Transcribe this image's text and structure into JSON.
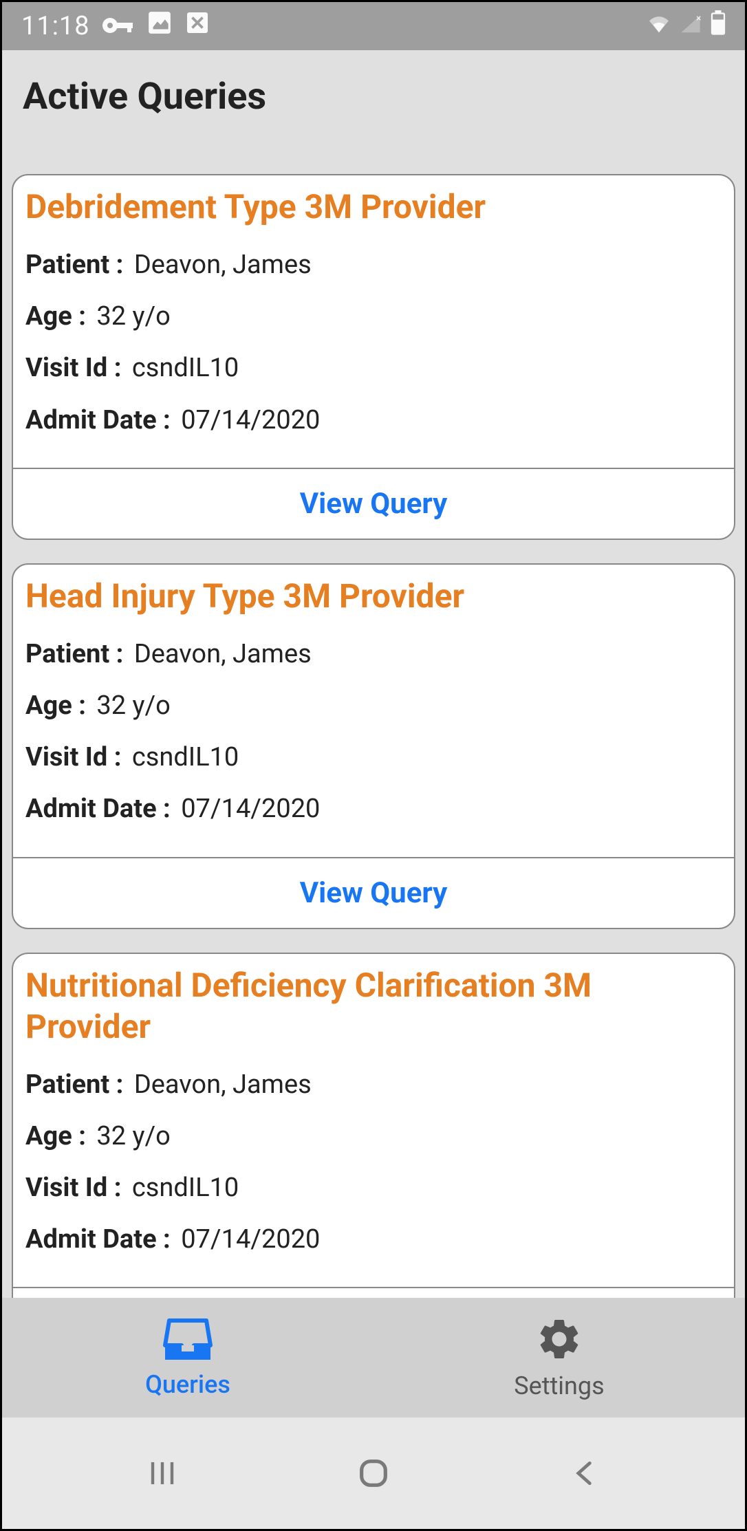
{
  "status_bar": {
    "time": "11:18"
  },
  "header": {
    "title": "Active Queries"
  },
  "labels": {
    "patient": "Patient :",
    "age": "Age :",
    "visit_id": "Visit Id :",
    "admit_date": "Admit Date :",
    "view_query": "View Query"
  },
  "queries": [
    {
      "title": "Debridement Type 3M Provider",
      "patient": "Deavon, James",
      "age": "32 y/o",
      "visit_id": "csndIL10",
      "admit_date": "07/14/2020"
    },
    {
      "title": "Head Injury Type 3M Provider",
      "patient": "Deavon, James",
      "age": "32 y/o",
      "visit_id": "csndIL10",
      "admit_date": "07/14/2020"
    },
    {
      "title": "Nutritional Deficiency Clarification 3M Provider",
      "patient": "Deavon, James",
      "age": "32 y/o",
      "visit_id": "csndIL10",
      "admit_date": "07/14/2020"
    }
  ],
  "tabs": {
    "queries": "Queries",
    "settings": "Settings"
  }
}
